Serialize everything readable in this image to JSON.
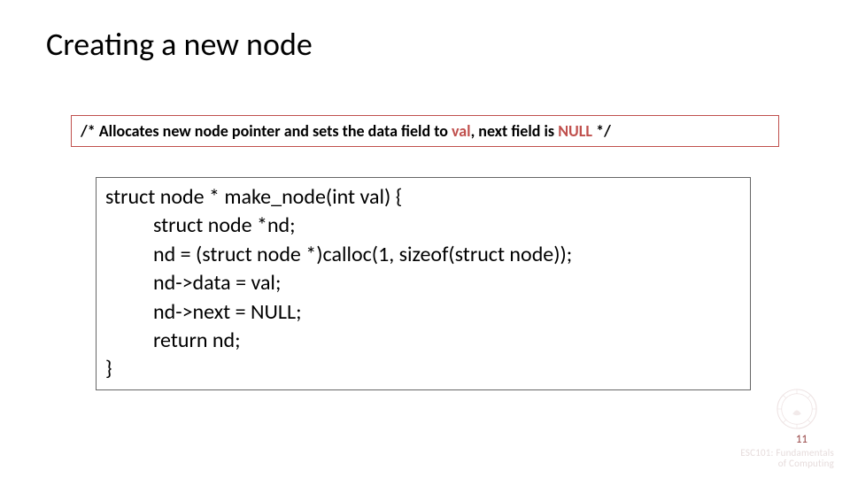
{
  "slide": {
    "title": "Creating a new node",
    "comment": {
      "prefix": "/* Allocates new node pointer and sets the  data field to ",
      "kw1": "val",
      "mid": ", next field is ",
      "kw2": "NULL",
      "suffix": " */"
    },
    "code": {
      "l1": "struct node * make_node(int val) {",
      "l2": "struct node *nd;",
      "l3": "nd = (struct node *)calloc(1, sizeof(struct node));",
      "l4": "nd->data = val;",
      "l5": "nd->next = NULL;",
      "l6": "return nd;",
      "l7": "}"
    },
    "page_number": "11",
    "course_l1": "ESC101: Fundamentals",
    "course_l2": "of Computing"
  }
}
